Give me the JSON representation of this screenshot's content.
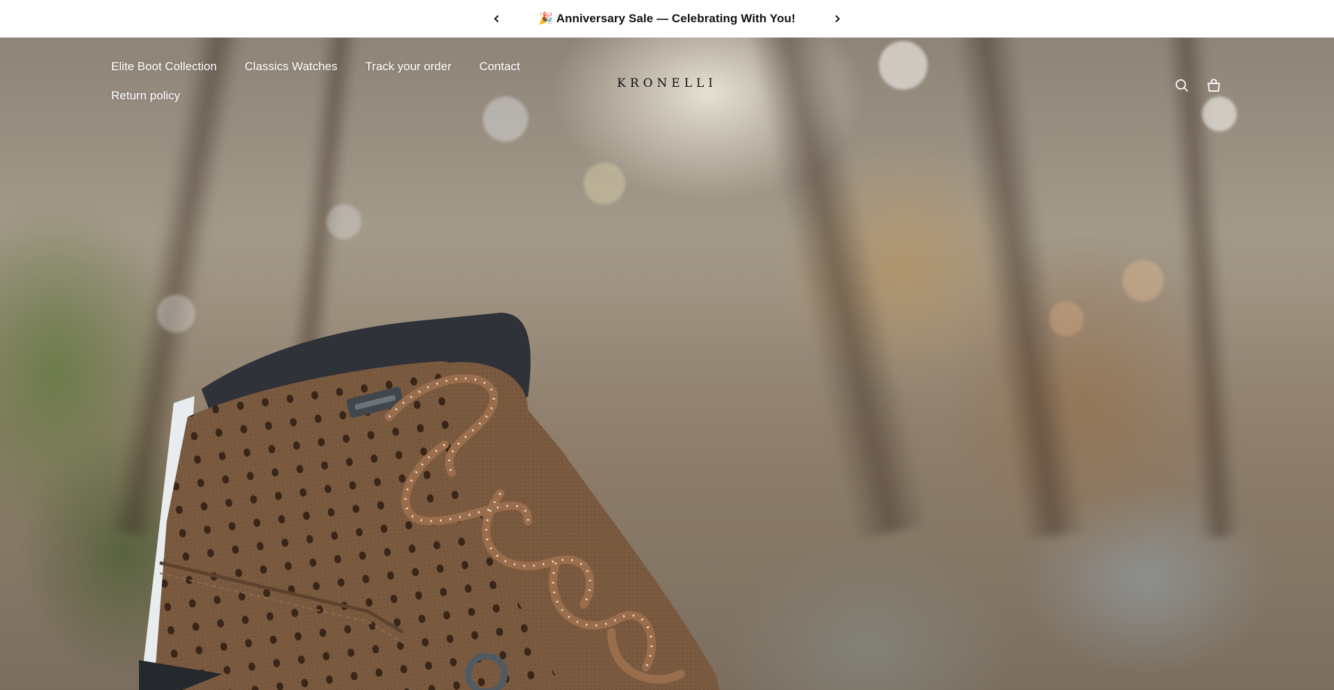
{
  "announcement": {
    "text": "🎉 Anniversary Sale — Celebrating With You!",
    "prev_icon": "chevron-left-icon",
    "next_icon": "chevron-right-icon"
  },
  "header": {
    "nav": [
      {
        "label": "Elite Boot Collection"
      },
      {
        "label": "Classics Watches"
      },
      {
        "label": "Track your order"
      },
      {
        "label": "Contact"
      },
      {
        "label": "Return policy"
      }
    ],
    "logo": "KRONELLI",
    "icons": [
      "search-icon",
      "cart-icon"
    ]
  },
  "hero": {
    "image": "hiking-boot-forest-photo"
  },
  "colors": {
    "announcement_bg": "#ffffff",
    "announcement_text": "#111111",
    "nav_text": "#ffffff",
    "logo_text": "#111111",
    "boot_brown": "#7a5a3e"
  }
}
